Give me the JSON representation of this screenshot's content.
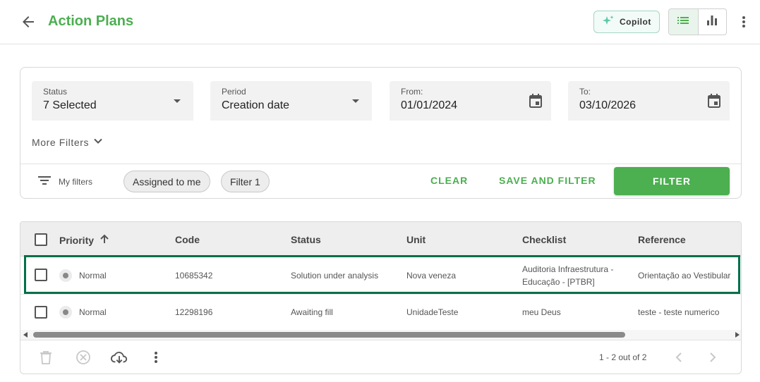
{
  "header": {
    "title": "Action Plans",
    "copilot_label": "Copilot"
  },
  "filters": {
    "status": {
      "label": "Status",
      "value": "7 Selected"
    },
    "period": {
      "label": "Period",
      "value": "Creation date"
    },
    "from": {
      "label": "From:",
      "value": "01/01/2024"
    },
    "to": {
      "label": "To:",
      "value": "03/10/2026"
    },
    "more_filters": "More Filters",
    "my_filters": "My filters",
    "chips": [
      "Assigned to me",
      "Filter 1"
    ],
    "clear_label": "CLEAR",
    "save_filter_label": "SAVE AND FILTER",
    "filter_label": "FILTER"
  },
  "table": {
    "columns": [
      "Priority",
      "Code",
      "Status",
      "Unit",
      "Checklist",
      "Reference"
    ],
    "rows": [
      {
        "priority": "Normal",
        "code": "10685342",
        "status": "Solution under analysis",
        "unit": "Nova veneza",
        "checklist_line1": "Auditoria Infraestrutura -",
        "checklist_line2": "Educação - [PTBR]",
        "reference": "Orientação ao Vestibular"
      },
      {
        "priority": "Normal",
        "code": "12298196",
        "status": "Awaiting fill",
        "unit": "UnidadeTeste",
        "checklist_line1": "meu Deus",
        "checklist_line2": "",
        "reference": "teste - teste numerico"
      }
    ],
    "pagination": "1 - 2 out of 2"
  },
  "colors": {
    "accent": "#4caf50",
    "selection_outline": "#00704a"
  }
}
